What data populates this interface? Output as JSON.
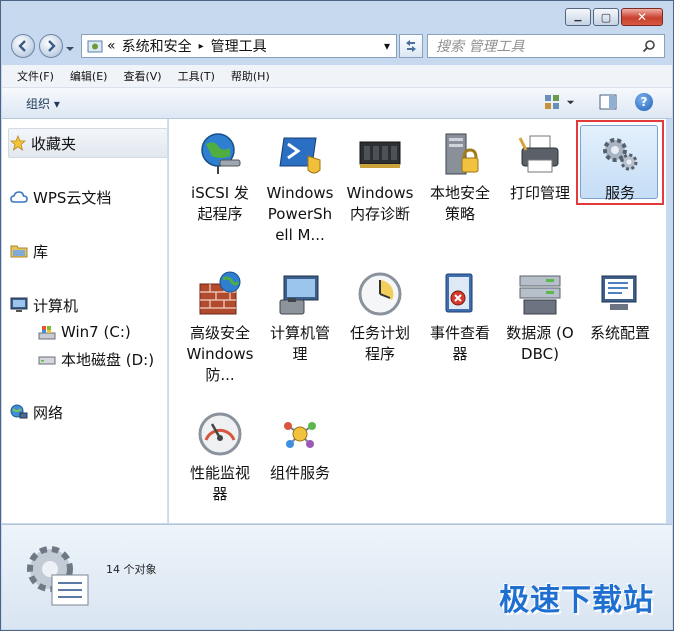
{
  "window": {
    "minimize_glyph": "▁",
    "maximize_glyph": "▢",
    "close_glyph": "✕"
  },
  "address": {
    "overflow_glyph": "«",
    "crumbs": [
      "系统和安全",
      "管理工具"
    ],
    "separator": "▸",
    "dropdown_glyph": "▾"
  },
  "search": {
    "placeholder": "搜索 管理工具"
  },
  "menubar": [
    "文件(F)",
    "编辑(E)",
    "查看(V)",
    "工具(T)",
    "帮助(H)"
  ],
  "toolbar": {
    "organize": "组织 ▾",
    "help_glyph": "?"
  },
  "sidebar": {
    "favorites": "收藏夹",
    "wps_cloud": "WPS云文档",
    "libraries": "库",
    "computer": "计算机",
    "drive_c": "Win7 (C:)",
    "drive_d": "本地磁盘 (D:)",
    "network": "网络"
  },
  "items": [
    {
      "label": "iSCSI 发起程序",
      "icon": "globe-network-icon"
    },
    {
      "label": "Windows PowerShell M...",
      "icon": "powershell-icon"
    },
    {
      "label": "Windows 内存诊断",
      "icon": "memory-chip-icon"
    },
    {
      "label": "本地安全策略",
      "icon": "server-lock-icon"
    },
    {
      "label": "打印管理",
      "icon": "printer-icon"
    },
    {
      "label": "服务",
      "icon": "gears-icon",
      "selected": true
    },
    {
      "label": "高级安全 Windows 防...",
      "icon": "firewall-icon"
    },
    {
      "label": "计算机管理",
      "icon": "computer-management-icon"
    },
    {
      "label": "任务计划程序",
      "icon": "clock-icon"
    },
    {
      "label": "事件查看器",
      "icon": "event-viewer-icon"
    },
    {
      "label": "数据源 (ODBC)",
      "icon": "database-icon"
    },
    {
      "label": "系统配置",
      "icon": "system-config-icon"
    },
    {
      "label": "性能监视器",
      "icon": "gauge-icon"
    },
    {
      "label": "组件服务",
      "icon": "component-services-icon"
    }
  ],
  "status": {
    "count": "14 个对象"
  },
  "watermark": "极速下载站",
  "colors": {
    "chrome": "#c7d9ef",
    "selection": "#c5ddf6",
    "highlight_border": "#e33b3b",
    "watermark": "#1f6fd1"
  }
}
